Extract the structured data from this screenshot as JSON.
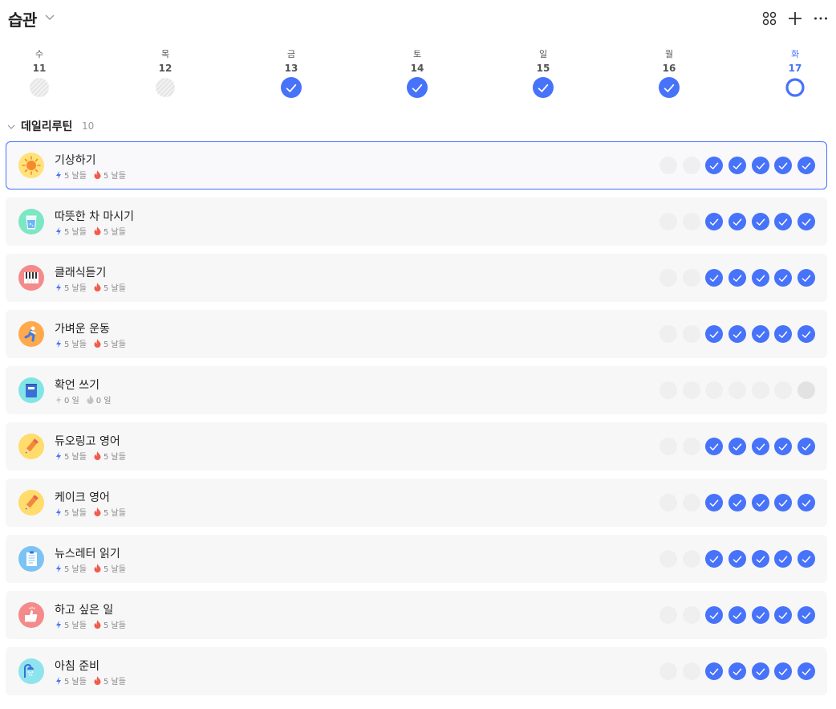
{
  "header": {
    "title": "습관"
  },
  "week": [
    {
      "name": "수",
      "num": "11",
      "status": "skipped"
    },
    {
      "name": "목",
      "num": "12",
      "status": "skipped"
    },
    {
      "name": "금",
      "num": "13",
      "status": "done"
    },
    {
      "name": "토",
      "num": "14",
      "status": "done"
    },
    {
      "name": "일",
      "num": "15",
      "status": "done"
    },
    {
      "name": "월",
      "num": "16",
      "status": "done"
    },
    {
      "name": "화",
      "num": "17",
      "status": "today"
    }
  ],
  "section": {
    "title": "데일리루틴",
    "count": "10"
  },
  "habits": [
    {
      "name": "기상하기",
      "icon": "sun-icon",
      "icon_bg": "#ffe27a",
      "streak1": "5 날들",
      "streak2": "5 날들",
      "active": true,
      "checks": [
        0,
        0,
        1,
        1,
        1,
        1,
        1
      ]
    },
    {
      "name": "따뜻한 차 마시기",
      "icon": "water-glass-icon",
      "icon_bg": "#7de6c4",
      "streak1": "5 날들",
      "streak2": "5 날들",
      "active": true,
      "checks": [
        0,
        0,
        1,
        1,
        1,
        1,
        1
      ]
    },
    {
      "name": "클래식듣기",
      "icon": "piano-icon",
      "icon_bg": "#f48a8a",
      "streak1": "5 날들",
      "streak2": "5 날들",
      "active": true,
      "checks": [
        0,
        0,
        1,
        1,
        1,
        1,
        1
      ]
    },
    {
      "name": "가벼운 운동",
      "icon": "runner-icon",
      "icon_bg": "#ffa94d",
      "streak1": "5 날들",
      "streak2": "5 날들",
      "active": true,
      "checks": [
        0,
        0,
        1,
        1,
        1,
        1,
        1
      ]
    },
    {
      "name": "확언 쓰기",
      "icon": "notebook-icon",
      "icon_bg": "#82e5e5",
      "streak1": "0 일",
      "streak2": "0 일",
      "active": false,
      "checks": [
        0,
        0,
        0,
        0,
        0,
        0,
        0
      ]
    },
    {
      "name": "듀오링고 영어",
      "icon": "pencil-icon",
      "icon_bg": "#ffdc6b",
      "streak1": "5 날들",
      "streak2": "5 날들",
      "active": true,
      "checks": [
        0,
        0,
        1,
        1,
        1,
        1,
        1
      ]
    },
    {
      "name": "케이크 영어",
      "icon": "pencil-icon",
      "icon_bg": "#ffdc6b",
      "streak1": "5 날들",
      "streak2": "5 날들",
      "active": true,
      "checks": [
        0,
        0,
        1,
        1,
        1,
        1,
        1
      ]
    },
    {
      "name": "뉴스레터 읽기",
      "icon": "document-icon",
      "icon_bg": "#7cc3f5",
      "streak1": "5 날들",
      "streak2": "5 날들",
      "active": true,
      "checks": [
        0,
        0,
        1,
        1,
        1,
        1,
        1
      ]
    },
    {
      "name": "하고 싶은 일",
      "icon": "thumbs-up-icon",
      "icon_bg": "#f48a8a",
      "streak1": "5 날들",
      "streak2": "5 날들",
      "active": true,
      "checks": [
        0,
        0,
        1,
        1,
        1,
        1,
        1
      ]
    },
    {
      "name": "아침 준비",
      "icon": "shower-icon",
      "icon_bg": "#8fe3ef",
      "streak1": "5 날들",
      "streak2": "5 날들",
      "active": true,
      "checks": [
        0,
        0,
        1,
        1,
        1,
        1,
        1
      ]
    }
  ],
  "colors": {
    "accent": "#4772fa",
    "bolt": "#4772fa",
    "flame": "#f25c4e",
    "inactive": "#c4c4c4"
  }
}
